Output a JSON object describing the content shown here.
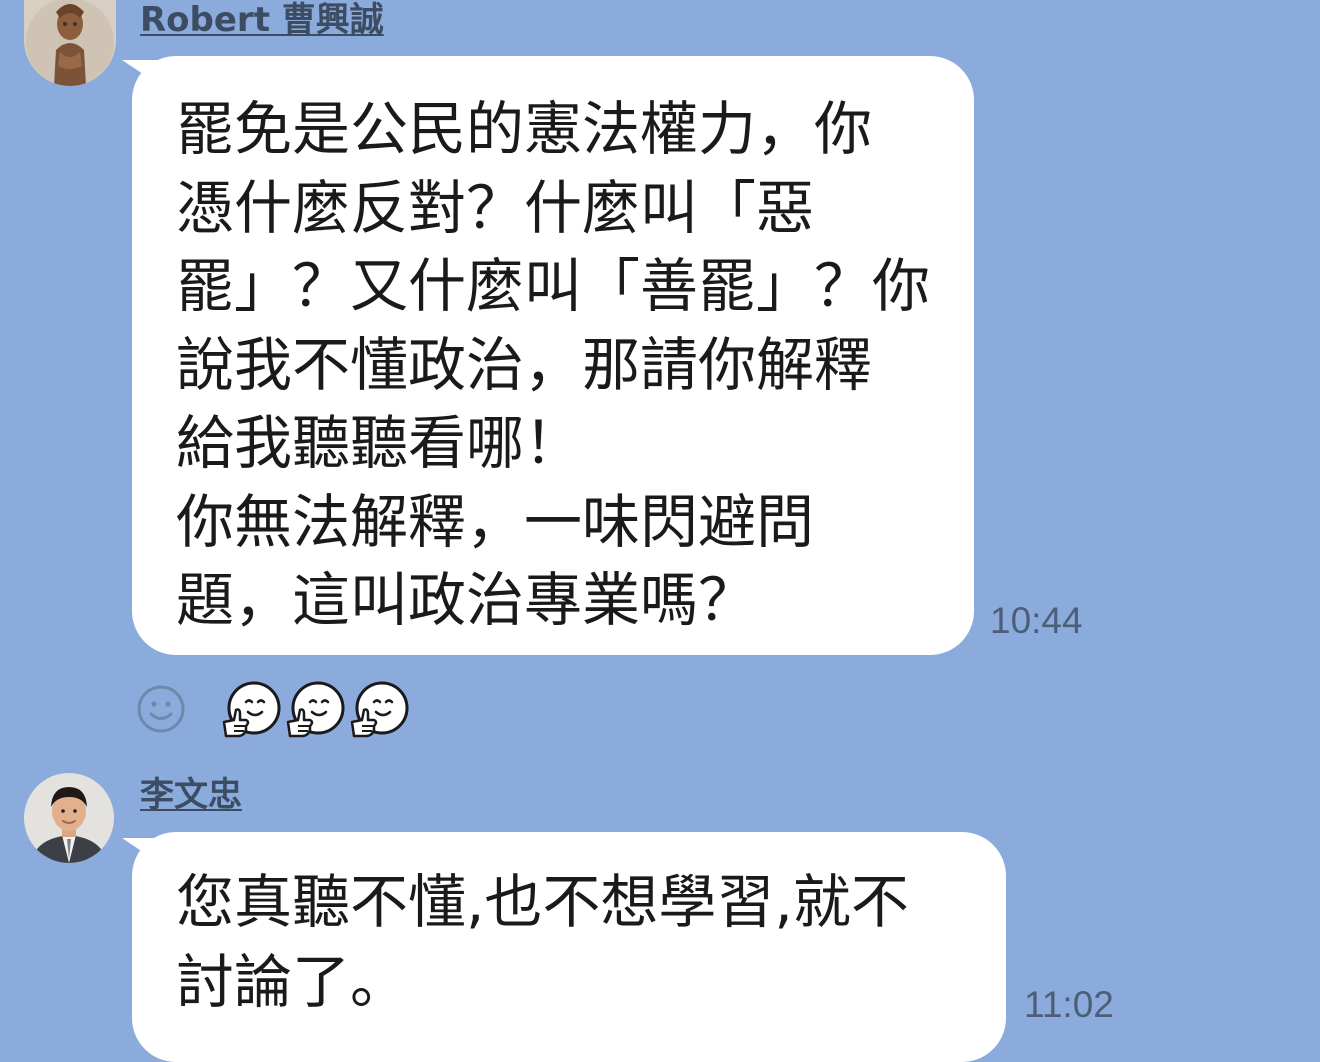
{
  "messages": [
    {
      "sender": "Robert 曹興誠",
      "avatar": "statue-avatar",
      "lines": [
        "罷免是公民的憲法權力，你",
        "憑什麼反對？什麼叫「惡",
        "罷」？又什麼叫「善罷」？你",
        "說我不懂政治，那請你解釋",
        "給我聽聽看哪！",
        "你無法解釋，一味閃避問",
        "題，這叫政治專業嗎？"
      ],
      "time": "10:44"
    },
    {
      "sender": "李文忠",
      "avatar": "man-in-suit-avatar",
      "lines": [
        "您真聽不懂,也不想學習,就不",
        "討論了。"
      ],
      "time": "11:02"
    }
  ],
  "reaction": {
    "add_icon": "smiley-outline-icon",
    "stickers": [
      "thumbs-up-smile-sticker",
      "thumbs-up-smile-sticker",
      "thumbs-up-smile-sticker"
    ]
  },
  "colors": {
    "background": "#8aabdb",
    "bubble": "#ffffff",
    "name": "#3c4d63",
    "time": "#4d5f78"
  }
}
